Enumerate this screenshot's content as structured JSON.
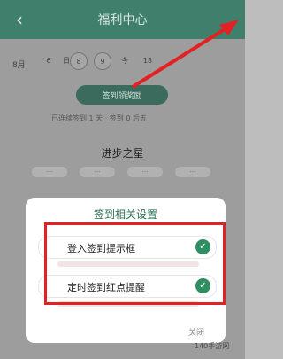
{
  "header": {
    "title": "福利中心",
    "back_icon": "chevron-left-icon"
  },
  "calendar": {
    "month": "8月",
    "days": [
      "6",
      "日",
      "8",
      "9",
      "今",
      "18"
    ]
  },
  "sign": {
    "button_label": "签到领奖励",
    "stats": "已连续签到 1 天  · 签到 0 后五"
  },
  "stars": {
    "title": "进步之星",
    "pills": [
      "···",
      "···",
      "···",
      "···"
    ]
  },
  "dialog": {
    "title": "签到相关设置",
    "options": [
      {
        "label": "登入签到提示框",
        "checked": true
      },
      {
        "label": "定时签到红点提醒",
        "checked": true
      }
    ],
    "close_label": "关闭"
  },
  "watermark": "140手游网",
  "colors": {
    "header": "#3f7f6c",
    "accent": "#2f8f62",
    "annotation": "#e22222"
  }
}
